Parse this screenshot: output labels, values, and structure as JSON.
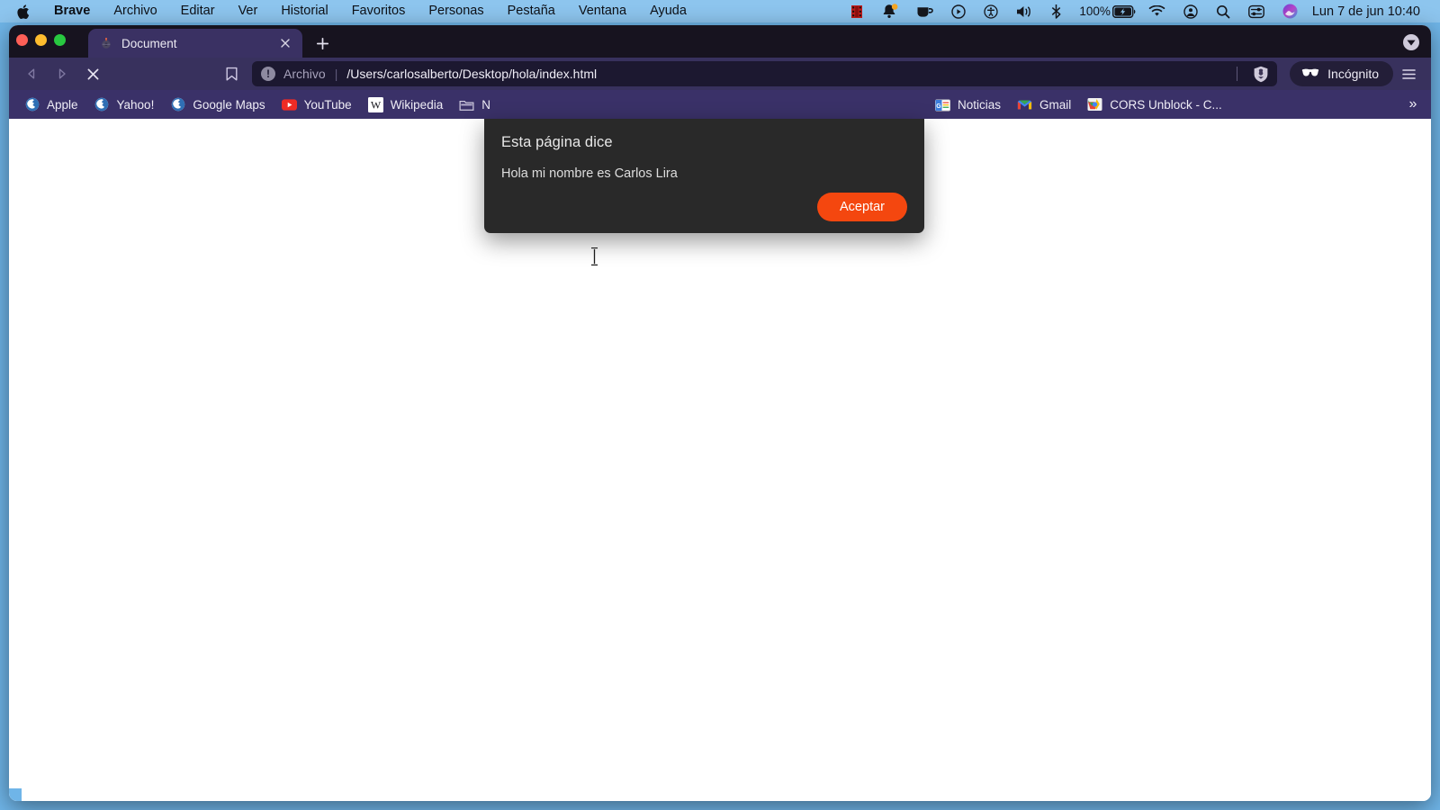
{
  "menubar": {
    "apple_icon": "apple-logo",
    "items": [
      {
        "label": "Brave",
        "bold": true
      },
      {
        "label": "Archivo",
        "bold": false
      },
      {
        "label": "Editar",
        "bold": false
      },
      {
        "label": "Ver",
        "bold": false
      },
      {
        "label": "Historial",
        "bold": false
      },
      {
        "label": "Favoritos",
        "bold": false
      },
      {
        "label": "Personas",
        "bold": false
      },
      {
        "label": "Pestaña",
        "bold": false
      },
      {
        "label": "Ventana",
        "bold": false
      },
      {
        "label": "Ayuda",
        "bold": false
      }
    ],
    "status": {
      "battery_percent": "100%",
      "clock": "Lun 7 de jun  10:40",
      "icons": [
        "film-strip-icon",
        "notification-bell-icon",
        "coffee-cup-icon",
        "play-circle-icon",
        "accessibility-icon",
        "volume-icon",
        "bluetooth-icon",
        "battery-charging-icon",
        "wifi-icon",
        "user-circle-icon",
        "spotlight-search-icon",
        "control-center-icon",
        "siri-icon"
      ]
    }
  },
  "window": {
    "traffic_lights": [
      "close-red",
      "minimize-yellow",
      "zoom-green"
    ],
    "tab": {
      "title": "Document",
      "favicon": "document-favicon",
      "close_icon": "close-icon"
    },
    "new_tab_label": "+",
    "tabstrip_right_icon": "brave-rewards-icon"
  },
  "toolbar": {
    "back_icon": "back-arrow-icon",
    "forward_icon": "forward-arrow-icon",
    "stop_icon": "stop-loading-icon",
    "bookmark_icon": "bookmark-star-icon",
    "omnibox": {
      "info_icon": "info-circle-icon",
      "scheme_label": "Archivo",
      "separator": "|",
      "url": "/Users/carlosalberto/Desktop/hola/index.html",
      "shield_icon": "brave-shields-icon"
    },
    "profile": {
      "label": "Incógnito",
      "icon": "incognito-glasses-icon"
    },
    "menu_icon": "hamburger-menu-icon"
  },
  "bookmarks": {
    "items": [
      {
        "label": "Apple",
        "icon": "globe-icon"
      },
      {
        "label": "Yahoo!",
        "icon": "globe-icon"
      },
      {
        "label": "Google Maps",
        "icon": "globe-icon"
      },
      {
        "label": "YouTube",
        "icon": "youtube-icon"
      },
      {
        "label": "Wikipedia",
        "icon": "wikipedia-icon"
      },
      {
        "label": "N",
        "icon": "folder-icon"
      },
      {
        "label": "Noticias",
        "icon": "google-news-icon"
      },
      {
        "label": "Gmail",
        "icon": "gmail-icon"
      },
      {
        "label": "CORS Unblock - C...",
        "icon": "chrome-extension-icon"
      }
    ],
    "overflow_label": "»"
  },
  "dialog": {
    "title": "Esta página dice",
    "message": "Hola mi nombre es Carlos Lira",
    "ok_label": "Aceptar",
    "accent_color": "#f4470f",
    "background_color": "#292929"
  },
  "page": {
    "background_color": "#ffffff",
    "content": ""
  }
}
